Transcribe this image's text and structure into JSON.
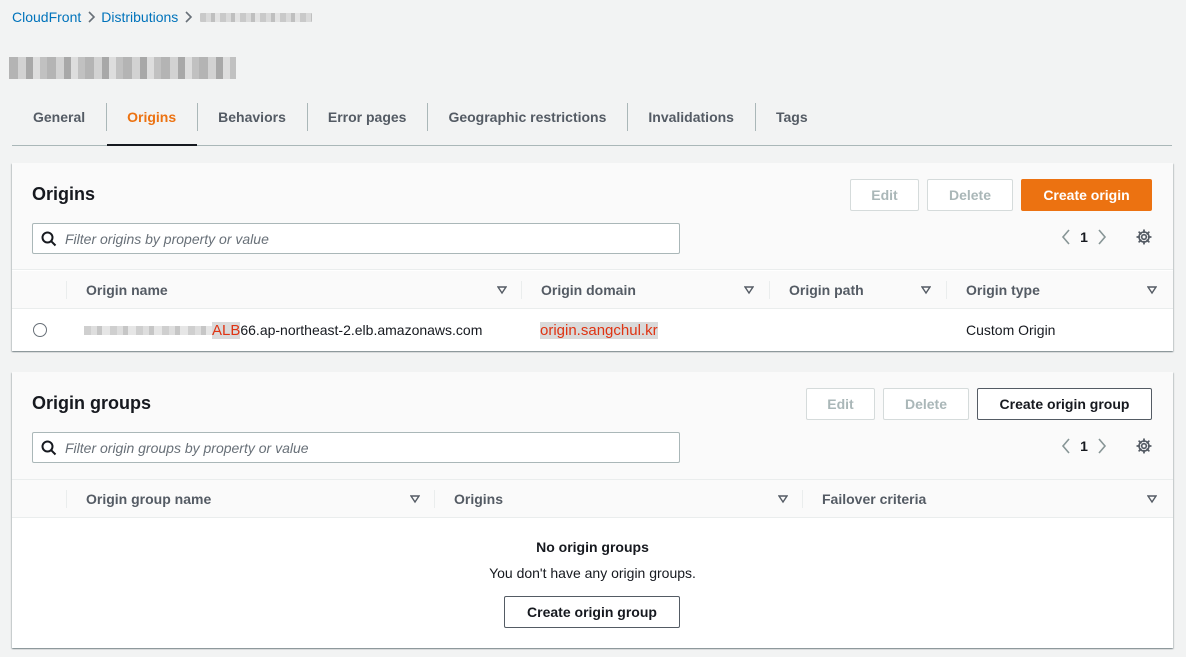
{
  "breadcrumb": {
    "root": "CloudFront",
    "section": "Distributions"
  },
  "tabs": [
    {
      "label": "General"
    },
    {
      "label": "Origins"
    },
    {
      "label": "Behaviors"
    },
    {
      "label": "Error pages"
    },
    {
      "label": "Geographic restrictions"
    },
    {
      "label": "Invalidations"
    },
    {
      "label": "Tags"
    }
  ],
  "origins": {
    "title": "Origins",
    "edit_label": "Edit",
    "delete_label": "Delete",
    "create_label": "Create origin",
    "filter_placeholder": "Filter origins by property or value",
    "page": "1",
    "columns": [
      "Origin name",
      "Origin domain",
      "Origin path",
      "Origin type"
    ],
    "rows": [
      {
        "name_redacted_tag": "ALB",
        "name_suffix": "66.ap-northeast-2.elb.amazonaws.com",
        "domain": "origin.sangchul.kr",
        "path": "",
        "type": "Custom Origin"
      }
    ]
  },
  "origin_groups": {
    "title": "Origin groups",
    "edit_label": "Edit",
    "delete_label": "Delete",
    "create_label": "Create origin group",
    "filter_placeholder": "Filter origin groups by property or value",
    "page": "1",
    "columns": [
      "Origin group name",
      "Origins",
      "Failover criteria"
    ],
    "empty_title": "No origin groups",
    "empty_desc": "You don't have any origin groups.",
    "empty_create_label": "Create origin group"
  },
  "colors": {
    "accent": "#ec7211",
    "link": "#0073bb",
    "redaction_text": "#df3312"
  }
}
